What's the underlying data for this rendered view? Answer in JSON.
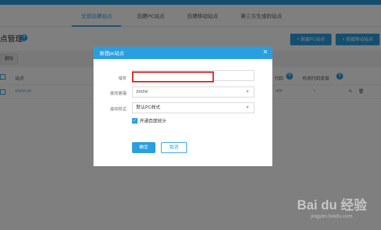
{
  "tabs": [
    {
      "label": "全部自建站点",
      "active": true
    },
    {
      "label": "自建PC站点",
      "active": false
    },
    {
      "label": "自建移动站点",
      "active": false
    },
    {
      "label": "第三方生成的站点",
      "active": false
    }
  ],
  "page": {
    "title": "点管理",
    "help_icon": "?",
    "new_pc_label": "+ 新建PC站点",
    "new_mobile_label": "+ 新建移动站点",
    "delete_label": "删除"
  },
  "table": {
    "headers": {
      "site": "站点",
      "code": "代码",
      "check": "检测代码安装"
    },
    "row": {
      "site": "clsze.cn",
      "code_icon": "</>",
      "gauge_icon": "◔",
      "edit_icon": "✎",
      "trash_icon": "🗑"
    }
  },
  "modal": {
    "title": "新建pc站点",
    "close": "×",
    "domain_label": "域名",
    "domain_value": "",
    "viewer_label": "接待客服",
    "viewer_value": "zsrzsr",
    "style_label": "接待样式",
    "style_value": "默认PC样式",
    "checkbox_label": "开通百度统计",
    "checkbox_checked": true,
    "ok_label": "确定",
    "cancel_label": "取消"
  },
  "watermark": {
    "text": "Bai du 经验",
    "sub": "jingyan.baidu.com"
  },
  "colors": {
    "accent": "#2a9fe0",
    "highlight": "#e02020"
  }
}
